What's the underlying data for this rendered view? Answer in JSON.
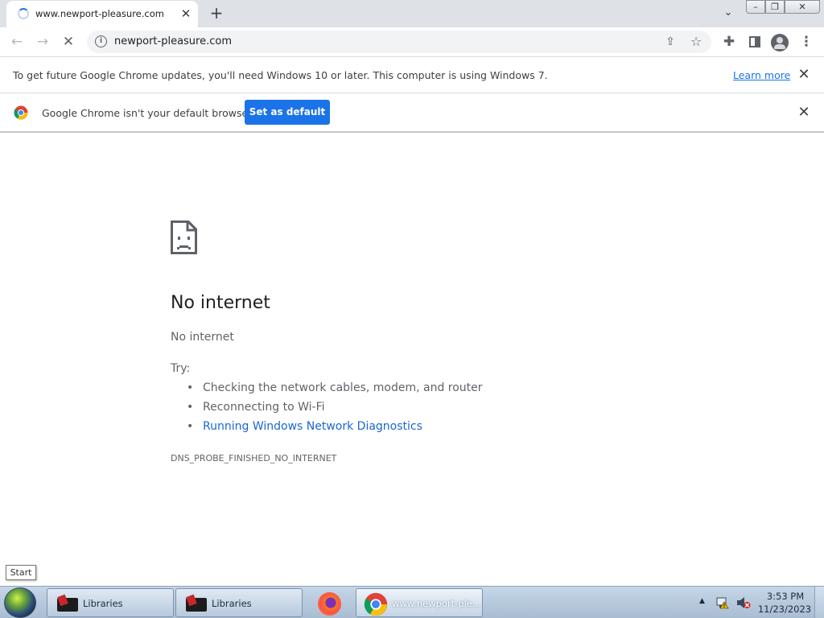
{
  "browser": {
    "tab": {
      "title": "www.newport-pleasure.com",
      "close_glyph": "✕"
    },
    "new_tab_glyph": "+",
    "tab_list_glyph": "⌄",
    "window_controls": {
      "minimize": "–",
      "maximize": "❐",
      "close": "✕"
    },
    "toolbar": {
      "back_glyph": "←",
      "forward_glyph": "→",
      "reload_glyph": "✕",
      "url": "newport-pleasure.com",
      "site_info_glyph": "i",
      "share_glyph": "⇪",
      "star_glyph": "☆",
      "extensions_glyph": "✚",
      "menu_glyph": "⋮"
    },
    "infobars": {
      "update": {
        "text": "To get future Google Chrome updates, you'll need Windows 10 or later. This computer is using Windows 7.",
        "link": "Learn more",
        "close_glyph": "✕"
      },
      "default_browser": {
        "text": "Google Chrome isn't your default browser",
        "button": "Set as default",
        "close_glyph": "✕"
      }
    }
  },
  "error_page": {
    "title": "No internet",
    "subtitle": "No internet",
    "try_label": "Try:",
    "suggestions": [
      "Checking the network cables, modem, and router",
      "Reconnecting to Wi-Fi",
      "Running Windows Network Diagnostics"
    ],
    "error_code": "DNS_PROBE_FINISHED_NO_INTERNET"
  },
  "taskbar": {
    "start_tooltip": "Start",
    "tasks": [
      {
        "label": "Libraries",
        "icon": "folder-icon"
      },
      {
        "label": "Libraries",
        "icon": "folder-icon"
      },
      {
        "label": "",
        "icon": "firefox-icon"
      },
      {
        "label": "www.newport-ple...",
        "icon": "chrome-icon"
      }
    ],
    "tray_arrow_glyph": "▲",
    "clock": {
      "time": "3:53 PM",
      "date": "11/23/2023"
    }
  },
  "colors": {
    "accent": "#1a73e8",
    "link": "#1967d2",
    "tabstrip": "#dee1e6",
    "taskbar": "#b8cadd"
  }
}
